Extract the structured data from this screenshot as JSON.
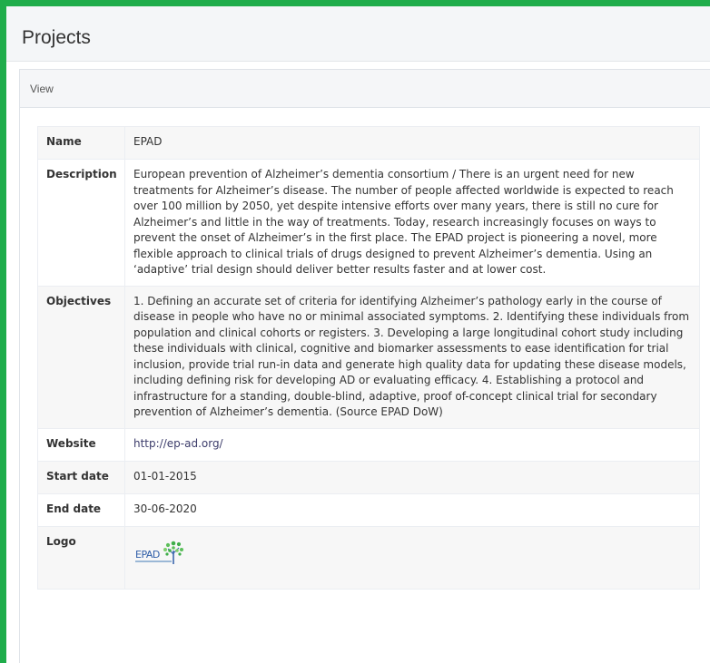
{
  "page": {
    "title": "Projects"
  },
  "panel": {
    "heading": "View"
  },
  "details": {
    "rows": [
      {
        "label": "Name",
        "value": "EPAD"
      },
      {
        "label": "Description",
        "value": "European prevention of Alzheimer’s dementia consortium / There is an urgent need for new treatments for Alzheimer’s disease. The number of people affected worldwide is expected to reach over 100 million by 2050, yet despite intensive efforts over many years, there is still no cure for Alzheimer’s and little in the way of treatments. Today, research increasingly focuses on ways to prevent the onset of Alzheimer’s in the first place. The EPAD project is pioneering a novel, more flexible approach to clinical trials of drugs designed to prevent Alzheimer’s dementia. Using an ‘adaptive’ trial design should deliver better results faster and at lower cost."
      },
      {
        "label": "Objectives",
        "value": "1. Defining an accurate set of criteria for identifying Alzheimer’s pathology early in the course of disease in people who have no or minimal associated symptoms. 2. Identifying these individuals from population and clinical cohorts or registers. 3. Developing a large longitudinal cohort study including these individuals with clinical, cognitive and biomarker assessments to ease identification for trial inclusion, provide trial run-in data and generate high quality data for updating these disease models, including defining risk for developing AD or evaluating efficacy. 4. Establishing a protocol and infrastructure for a standing, double-blind, adaptive, proof of-concept clinical trial for secondary prevention of Alzheimer’s dementia. (Source EPAD DoW)"
      },
      {
        "label": "Website",
        "value": "http://ep-ad.org/"
      },
      {
        "label": "Start date",
        "value": "01-01-2015"
      },
      {
        "label": "End date",
        "value": "30-06-2020"
      },
      {
        "label": "Logo",
        "logo_text": "EPAD"
      }
    ]
  },
  "colors": {
    "accent_border": "#1fad4b",
    "link": "#3d3d6b",
    "logo_blue": "#2f5ea8",
    "logo_green": "#3fae49"
  },
  "icons": {
    "logo": "epad-tree-logo"
  }
}
